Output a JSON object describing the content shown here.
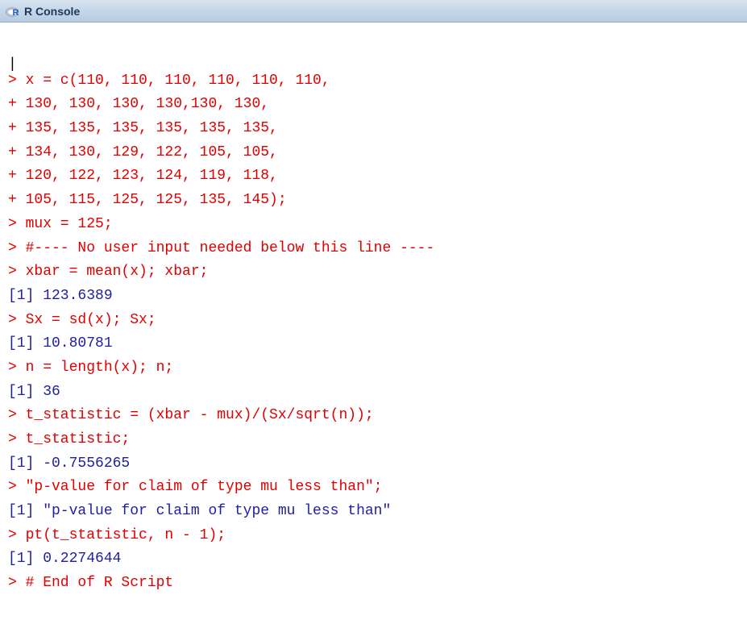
{
  "window": {
    "title": "R Console"
  },
  "console": {
    "lines": [
      {
        "type": "cursor",
        "text": "|"
      },
      {
        "type": "input",
        "text": "> x = c(110, 110, 110, 110, 110, 110,"
      },
      {
        "type": "input",
        "text": "+ 130, 130, 130, 130,130, 130,"
      },
      {
        "type": "input",
        "text": "+ 135, 135, 135, 135, 135, 135,"
      },
      {
        "type": "input",
        "text": "+ 134, 130, 129, 122, 105, 105,"
      },
      {
        "type": "input",
        "text": "+ 120, 122, 123, 124, 119, 118,"
      },
      {
        "type": "input",
        "text": "+ 105, 115, 125, 125, 135, 145);"
      },
      {
        "type": "input",
        "text": "> mux = 125;"
      },
      {
        "type": "input",
        "text": "> #---- No user input needed below this line ----"
      },
      {
        "type": "input",
        "text": "> xbar = mean(x); xbar;"
      },
      {
        "type": "output",
        "text": "[1] 123.6389"
      },
      {
        "type": "input",
        "text": "> Sx = sd(x); Sx;"
      },
      {
        "type": "output",
        "text": "[1] 10.80781"
      },
      {
        "type": "input",
        "text": "> n = length(x); n;"
      },
      {
        "type": "output",
        "text": "[1] 36"
      },
      {
        "type": "input",
        "text": "> t_statistic = (xbar - mux)/(Sx/sqrt(n));"
      },
      {
        "type": "input",
        "text": "> t_statistic;"
      },
      {
        "type": "output",
        "text": "[1] -0.7556265"
      },
      {
        "type": "input",
        "text": "> \"p-value for claim of type mu less than\";"
      },
      {
        "type": "output",
        "text": "[1] \"p-value for claim of type mu less than\""
      },
      {
        "type": "input",
        "text": "> pt(t_statistic, n - 1);"
      },
      {
        "type": "output",
        "text": "[1] 0.2274644"
      },
      {
        "type": "input",
        "text": "> # End of R Script"
      }
    ]
  }
}
